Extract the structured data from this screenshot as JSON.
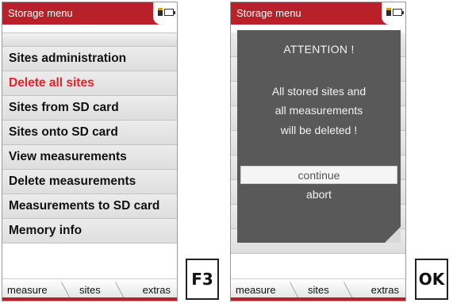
{
  "left_screen": {
    "title": "Storage menu",
    "menu_items": [
      "Sites administration",
      "Delete all sites",
      "Sites from SD card",
      "Sites onto SD card",
      "View measurements",
      "Delete measurements",
      "Measurements to SD card",
      "Memory info"
    ],
    "highlighted_item": "Delete all sites",
    "softkeys": [
      "measure",
      "sites",
      "extras"
    ]
  },
  "right_screen": {
    "title": "Storage menu",
    "dialog": {
      "title": "ATTENTION !",
      "message_lines": [
        "All stored sites and",
        "all measurements",
        "will be deleted !"
      ],
      "options": [
        "continue",
        "abort"
      ],
      "selected_option": "continue"
    },
    "softkeys": [
      "measure",
      "sites",
      "extras"
    ]
  },
  "keys": {
    "left": "F3",
    "right": "OK"
  },
  "icons": [
    "sd-card-icon",
    "battery-icon"
  ],
  "colors": {
    "brand_red": "#b8202a",
    "alert_red": "#e8202a",
    "dialog_bg": "#595959"
  }
}
